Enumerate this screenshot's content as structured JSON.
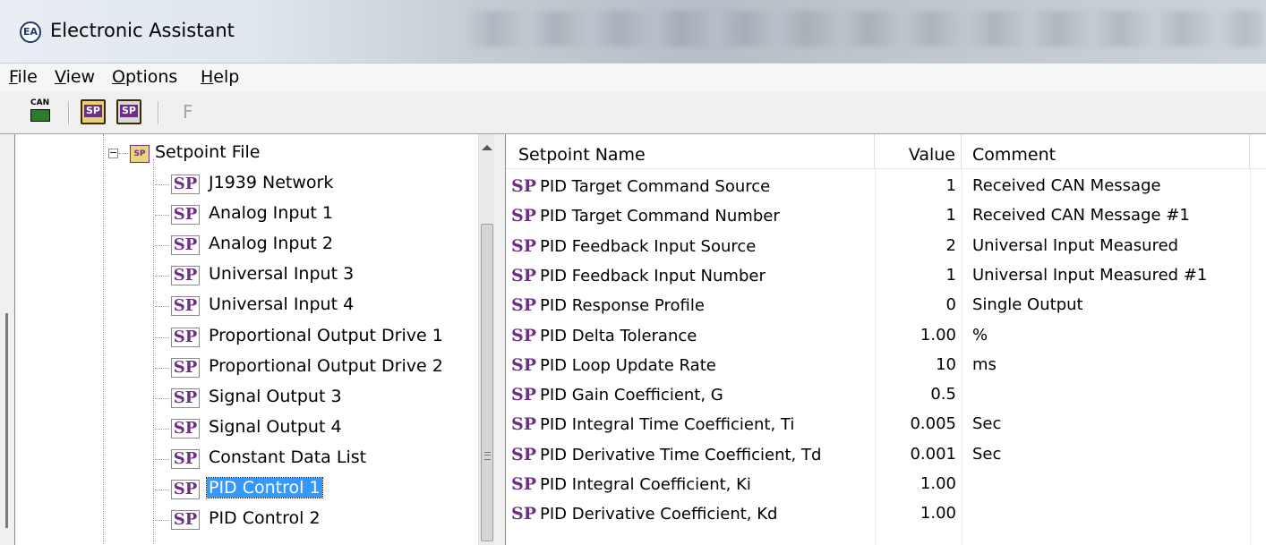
{
  "window": {
    "title": "Electronic Assistant",
    "icon_text": "EA"
  },
  "menu": {
    "items": [
      {
        "accel": "F",
        "rest": "ile"
      },
      {
        "accel": "V",
        "rest": "iew"
      },
      {
        "accel": "O",
        "rest": "ptions"
      },
      {
        "accel": "H",
        "rest": "elp"
      }
    ]
  },
  "toolbar": {
    "can_label": "CAN",
    "sp_label": "SP",
    "f_label": "F"
  },
  "tree": {
    "root_icon": "SP",
    "root_label": "Setpoint File",
    "item_icon": "SP",
    "items": [
      "J1939 Network",
      "Analog Input 1",
      "Analog Input 2",
      "Universal Input 3",
      "Universal Input 4",
      "Proportional Output Drive 1",
      "Proportional Output Drive 2",
      "Signal Output 3",
      "Signal Output 4",
      "Constant Data List",
      "PID Control 1",
      "PID Control 2"
    ],
    "selected": "PID Control 1"
  },
  "table": {
    "columns": [
      "Setpoint Name",
      "Value",
      "Comment"
    ],
    "sp_mark": "SP",
    "rows": [
      {
        "name": "PID Target Command Source",
        "value": "1",
        "comment": "Received CAN Message"
      },
      {
        "name": "PID Target Command Number",
        "value": "1",
        "comment": "Received CAN Message #1"
      },
      {
        "name": "PID Feedback Input Source",
        "value": "2",
        "comment": "Universal Input Measured"
      },
      {
        "name": "PID Feedback Input Number",
        "value": "1",
        "comment": "Universal Input Measured #1"
      },
      {
        "name": "PID Response Profile",
        "value": "0",
        "comment": "Single Output"
      },
      {
        "name": "PID Delta Tolerance",
        "value": "1.00",
        "comment": "%"
      },
      {
        "name": "PID Loop Update Rate",
        "value": "10",
        "comment": "ms"
      },
      {
        "name": "PID Gain Coefficient, G",
        "value": "0.5",
        "comment": ""
      },
      {
        "name": "PID Integral Time Coefficient, Ti",
        "value": "0.005",
        "comment": "Sec"
      },
      {
        "name": "PID Derivative Time Coefficient, Td",
        "value": "0.001",
        "comment": "Sec"
      },
      {
        "name": "PID Integral Coefficient, Ki",
        "value": "1.00",
        "comment": ""
      },
      {
        "name": "PID Derivative Coefficient, Kd",
        "value": "1.00",
        "comment": ""
      }
    ]
  },
  "colors": {
    "sp_purple": "#6b2f86",
    "selection_blue": "#3399ff"
  }
}
